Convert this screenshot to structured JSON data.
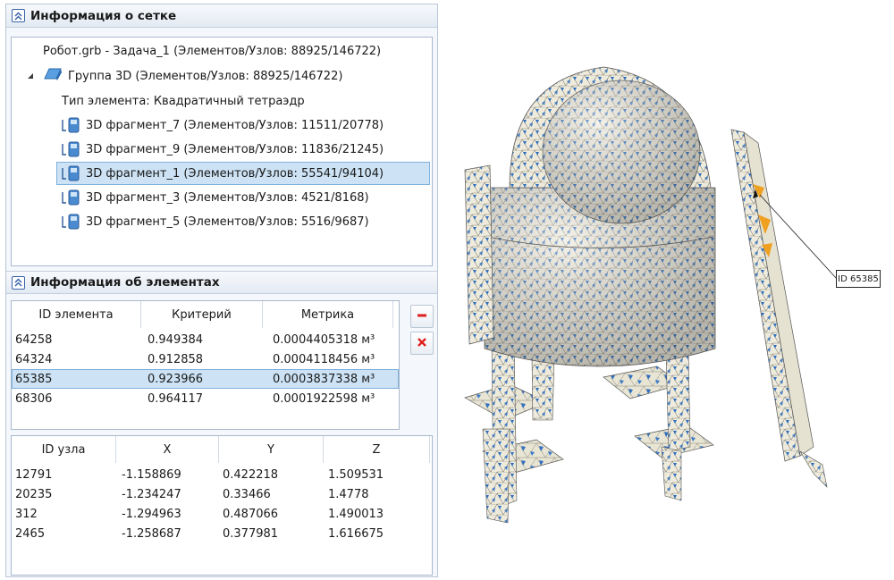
{
  "mesh_section": {
    "title": "Информация о сетке",
    "tree": {
      "root": "Робот.grb - Задача_1 (Элементов/Узлов: 88925/146722)",
      "group": "Группа 3D (Элементов/Узлов: 88925/146722)",
      "element_type": "Тип элемента: Квадратичный тетраэдр",
      "fragments": [
        {
          "label": "3D фрагмент_7 (Элементов/Узлов: 11511/20778)",
          "selected": false
        },
        {
          "label": "3D фрагмент_9 (Элементов/Узлов: 11836/21245)",
          "selected": false
        },
        {
          "label": "3D фрагмент_1 (Элементов/Узлов: 55541/94104)",
          "selected": true
        },
        {
          "label": "3D фрагмент_3 (Элементов/Узлов: 4521/8168)",
          "selected": false
        },
        {
          "label": "3D фрагмент_5 (Элементов/Узлов: 5516/9687)",
          "selected": false
        }
      ]
    }
  },
  "elements_section": {
    "title": "Информация об элементах",
    "columns": [
      "ID элемента",
      "Критерий",
      "Метрика"
    ],
    "rows": [
      {
        "id": "64258",
        "criterion": "0.949384",
        "metric": "0.0004405318 м³",
        "selected": false
      },
      {
        "id": "64324",
        "criterion": "0.912858",
        "metric": "0.0004118456 м³",
        "selected": false
      },
      {
        "id": "65385",
        "criterion": "0.923966",
        "metric": "0.0003837338 м³",
        "selected": true
      },
      {
        "id": "68306",
        "criterion": "0.964117",
        "metric": "0.0001922598 м³",
        "selected": false
      }
    ]
  },
  "nodes_section": {
    "columns": [
      "ID узла",
      "X",
      "Y",
      "Z"
    ],
    "rows": [
      {
        "id": "12791",
        "x": "-1.158869",
        "y": "0.422218",
        "z": "1.509531"
      },
      {
        "id": "20235",
        "x": "-1.234247",
        "y": "0.33466",
        "z": "1.4778"
      },
      {
        "id": "312",
        "x": "-1.294963",
        "y": "0.487066",
        "z": "1.490013"
      },
      {
        "id": "2465",
        "x": "-1.258687",
        "y": "0.377981",
        "z": "1.616675"
      }
    ]
  },
  "viewport": {
    "callout_label": "ID 65385"
  },
  "icons": {
    "collapse": "double-chevron-up-icon",
    "remove": "minus-icon",
    "delete": "x-icon",
    "group": "3d-group-icon",
    "fragment": "fragment-icon"
  },
  "colors": {
    "selection": "#cde3f5",
    "mesh_blue": "#2f6fbf",
    "mesh_base": "#eeebdc",
    "highlight": "#f0a020",
    "remove_red": "#e02020"
  }
}
